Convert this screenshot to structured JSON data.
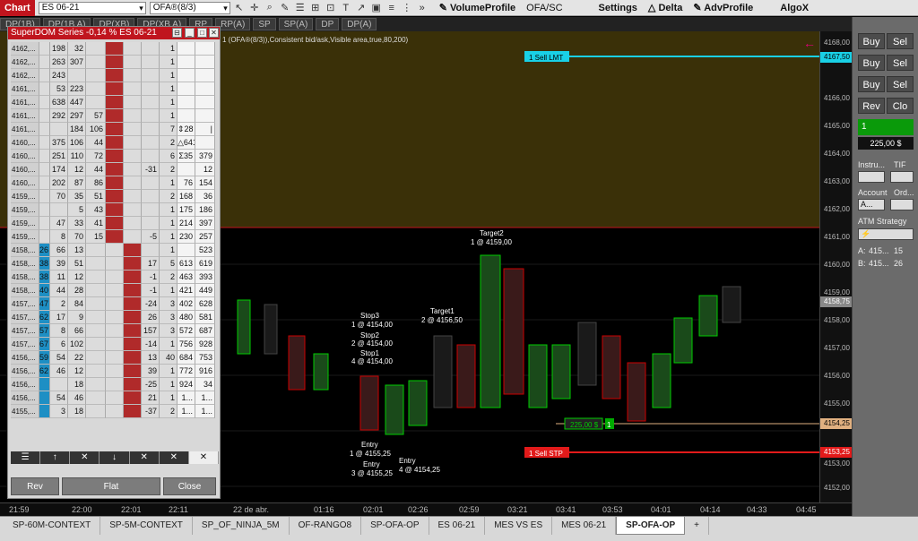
{
  "toolbar": {
    "chart_tab": "Chart",
    "instrument": "ES 06-21",
    "indicator": "OFA®(8/3)",
    "items": [
      "VolumeProfile",
      "OFA/SC",
      "Settings",
      "Delta",
      "AdvProfile",
      "AlgoX"
    ]
  },
  "data_tabs": [
    "DP(1B)",
    "DP(1B A)",
    "DP(XB)",
    "DP(XB A)",
    "RP",
    "RP(A)",
    "SP",
    "SP(A)",
    "DP",
    "DP(A)"
  ],
  "chart": {
    "header": "1 (OFA®(8/3)),Consistent bid/ask,Visible area,true,80,200)",
    "price_labels": [
      "4168,00",
      "4167,50",
      "4166,00",
      "4165,00",
      "4164,00",
      "4163,00",
      "4162,00",
      "4161,00",
      "4160,00",
      "4159,00",
      "4158,75",
      "4158,00",
      "4157,00",
      "4156,00",
      "4155,00",
      "4154,25",
      "4153,25",
      "4153,00",
      "4152,00"
    ],
    "sell_lmt": "1  Sell LMT",
    "sell_stp": "1  Sell STP",
    "pnl_box": "225,00 $",
    "pnl_qty": "1",
    "annotations": {
      "target2": "Target2",
      "target2_fill": "1 @ 4159,00",
      "target1": "Target1",
      "target1_fill": "2 @ 4156,50",
      "stop3": "Stop3",
      "stop3_fill": "1 @ 4154,00",
      "stop2": "Stop2",
      "stop2_fill": "2 @ 4154,00",
      "stop1": "Stop1",
      "stop1_fill": "4 @ 4154,00",
      "entry1": "Entry",
      "entry1_fill": "1 @ 4155,25",
      "entry2": "Entry",
      "entry2_fill": "3 @ 4155,25",
      "entry3": "Entry",
      "entry3_fill": "4 @ 4154,25"
    },
    "time_labels": [
      "21:59",
      "22:00",
      "22:01",
      "22:11",
      "22 de abr.",
      "01:16",
      "02:01",
      "02:26",
      "02:59",
      "03:21",
      "03:41",
      "03:53",
      "04:01",
      "04:14",
      "04:33",
      "04:45"
    ]
  },
  "superdom": {
    "title": "SuperDOM Series -0,14 % ES 06-21",
    "rows": [
      [
        "4162,...",
        "",
        "198",
        "32",
        "",
        "",
        "",
        "",
        "1",
        "",
        ""
      ],
      [
        "4162,...",
        "",
        "263",
        "307",
        "",
        "",
        "",
        "",
        "1",
        "",
        ""
      ],
      [
        "4162,...",
        "",
        "243",
        "",
        "",
        "",
        "",
        "",
        "1",
        "",
        ""
      ],
      [
        "4161,...",
        "",
        "53",
        "223",
        "",
        "",
        "",
        "",
        "1",
        "",
        ""
      ],
      [
        "4161,...",
        "",
        "638",
        "447",
        "",
        "",
        "",
        "",
        "1",
        "",
        ""
      ],
      [
        "4161,...",
        "",
        "292",
        "297",
        "57",
        "",
        "",
        "",
        "1",
        "",
        ""
      ],
      [
        "4161,...",
        "",
        "",
        "184",
        "106",
        "",
        "",
        "",
        "7",
        "⇕28",
        "|"
      ],
      [
        "4160,...",
        "",
        "375",
        "106",
        "44",
        "",
        "",
        "",
        "2",
        "△641",
        ""
      ],
      [
        "4160,...",
        "",
        "251",
        "110",
        "72",
        "",
        "",
        "",
        "6",
        "Σ35",
        "379"
      ],
      [
        "4160,...",
        "",
        "174",
        "12",
        "44",
        "",
        "",
        "-31",
        "2",
        "",
        "12"
      ],
      [
        "4160,...",
        "",
        "202",
        "87",
        "86",
        "",
        "",
        "",
        "1",
        "76",
        "154"
      ],
      [
        "4159,...",
        "",
        "70",
        "35",
        "51",
        "",
        "",
        "",
        "2",
        "168",
        "36"
      ],
      [
        "4159,...",
        "",
        "",
        "5",
        "43",
        "",
        "",
        "",
        "1",
        "175",
        "186"
      ],
      [
        "4159,...",
        "",
        "47",
        "33",
        "41",
        "",
        "",
        "",
        "1",
        "214",
        "397"
      ],
      [
        "4159,...",
        "",
        "8",
        "70",
        "15",
        "",
        "",
        "-5",
        "1",
        "230",
        "257"
      ],
      [
        "4158,...",
        "26",
        "66",
        "13",
        "",
        "",
        "",
        "",
        "1",
        "",
        "523"
      ],
      [
        "4158,...",
        "38",
        "39",
        "51",
        "",
        "",
        "",
        "17",
        "5",
        "613",
        "619"
      ],
      [
        "4158,...",
        "38",
        "11",
        "12",
        "",
        "",
        "",
        "-1",
        "2",
        "463",
        "393"
      ],
      [
        "4158,...",
        "40",
        "44",
        "28",
        "",
        "",
        "",
        "-1",
        "1",
        "421",
        "449"
      ],
      [
        "4157,...",
        "47",
        "2",
        "84",
        "",
        "",
        "",
        "-24",
        "3",
        "402",
        "628"
      ],
      [
        "4157,...",
        "62",
        "17",
        "9",
        "",
        "",
        "",
        "26",
        "3",
        "480",
        "581"
      ],
      [
        "4157,...",
        "57",
        "8",
        "66",
        "",
        "",
        "",
        "157",
        "3",
        "572",
        "687"
      ],
      [
        "4157,...",
        "67",
        "6",
        "102",
        "",
        "",
        "",
        "-14",
        "1",
        "756",
        "928"
      ],
      [
        "4156,...",
        "59",
        "54",
        "22",
        "",
        "",
        "",
        "13",
        "40",
        "684",
        "753"
      ],
      [
        "4156,...",
        "62",
        "46",
        "12",
        "",
        "",
        "",
        "39",
        "1",
        "772",
        "916"
      ],
      [
        "4156,...",
        "",
        "",
        "18",
        "",
        "",
        "",
        "-25",
        "1",
        "924",
        "34"
      ],
      [
        "4156,...",
        "",
        "54",
        "46",
        "",
        "",
        "",
        "21",
        "1",
        "1...",
        "1..."
      ],
      [
        "4155,...",
        "",
        "3",
        "18",
        "",
        "",
        "",
        "-37",
        "2",
        "1...",
        "1..."
      ]
    ],
    "buttons": [
      "Rev",
      "Flat",
      "Close"
    ]
  },
  "right_panel": {
    "buy": "Buy",
    "sell": "Sel",
    "rev": "Rev",
    "close": "Clo",
    "qty": "1",
    "pnl": "225,00 $",
    "instrument_label": "Instru...",
    "tif_label": "TIF",
    "account_label": "Account",
    "order_label": "Ord...",
    "atm_label": "ATM Strategy",
    "account_value": "A...",
    "ask_label": "A:",
    "ask_price": "415...",
    "ask_qty": "15",
    "bid_label": "B:",
    "bid_price": "415...",
    "bid_qty": "26"
  },
  "bottom_tabs": [
    "SP-60M-CONTEXT",
    "SP-5M-CONTEXT",
    "SP_OF_NINJA_5M",
    "OF-RANGO8",
    "SP-OFA-OP",
    "ES 06-21",
    "MES VS ES",
    "MES 06-21",
    "SP-OFA-OP"
  ],
  "colors": {
    "accent_red": "#c0151e",
    "bid_blue": "#1e8fc4",
    "ask_red": "#b02a2a",
    "sell_lmt": "#19d0e6",
    "sell_stp": "#e21a1a"
  }
}
